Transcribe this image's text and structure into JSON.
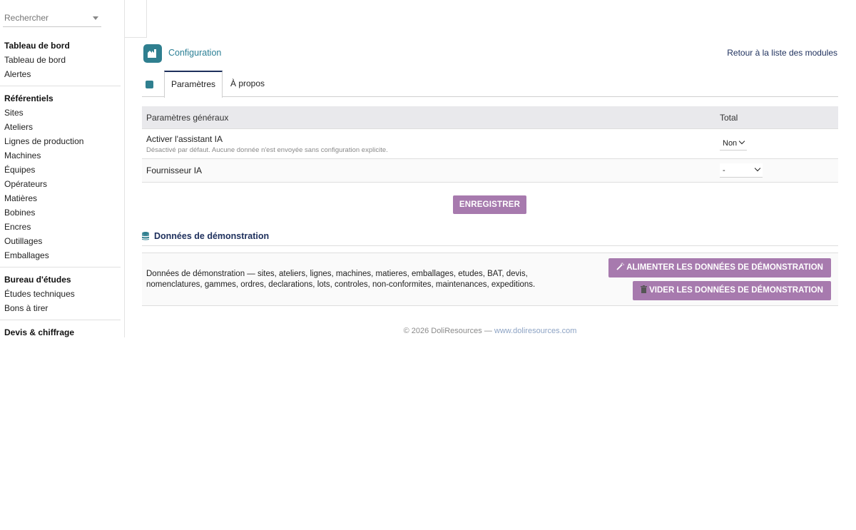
{
  "search": {
    "placeholder": "Rechercher"
  },
  "sidebar": {
    "groups": [
      {
        "title": "Tableau de bord",
        "items": [
          "Tableau de bord",
          "Alertes"
        ]
      },
      {
        "title": "Référentiels",
        "items": [
          "Sites",
          "Ateliers",
          "Lignes de production",
          "Machines",
          "Équipes",
          "Opérateurs",
          "Matières",
          "Bobines",
          "Encres",
          "Outillages",
          "Emballages"
        ]
      },
      {
        "title": "Bureau d'études",
        "items": [
          "Études techniques",
          "Bons à tirer"
        ]
      },
      {
        "title": "Devis & chiffrage",
        "items": []
      }
    ]
  },
  "header": {
    "title": "Configuration",
    "back_link": "Retour à la liste des modules"
  },
  "tabs": [
    {
      "label": "Paramètres",
      "active": true
    },
    {
      "label": "À propos",
      "active": false
    }
  ],
  "params": {
    "col_name": "Paramètres généraux",
    "col_total": "Total",
    "rows": [
      {
        "label": "Activer l'assistant IA",
        "desc": "Désactivé par défaut. Aucune donnée n'est envoyée sans configuration explicite.",
        "value": "Non"
      },
      {
        "label": "Fournisseur IA",
        "desc": "",
        "value": "-"
      }
    ]
  },
  "save_button": "ENREGISTRER",
  "demo": {
    "title": "Données de démonstration",
    "text": "Données de démonstration — sites, ateliers, lignes, machines, matieres, emballages, etudes, BAT, devis, nomenclatures, gammes, ordres, declarations, lots, controles, non-conformites, maintenances, expeditions.",
    "feed_button": "ALIMENTER LES DONNÉES DE DÉMONSTRATION",
    "empty_button": "VIDER LES DONNÉES DE DÉMONSTRATION"
  },
  "footer": {
    "copyright": "© 2026 DoliResources — ",
    "link": "www.doliresources.com"
  },
  "colors": {
    "accent": "#a77aae",
    "brand": "#2f7f8f",
    "nav": "#1d2f5c"
  }
}
